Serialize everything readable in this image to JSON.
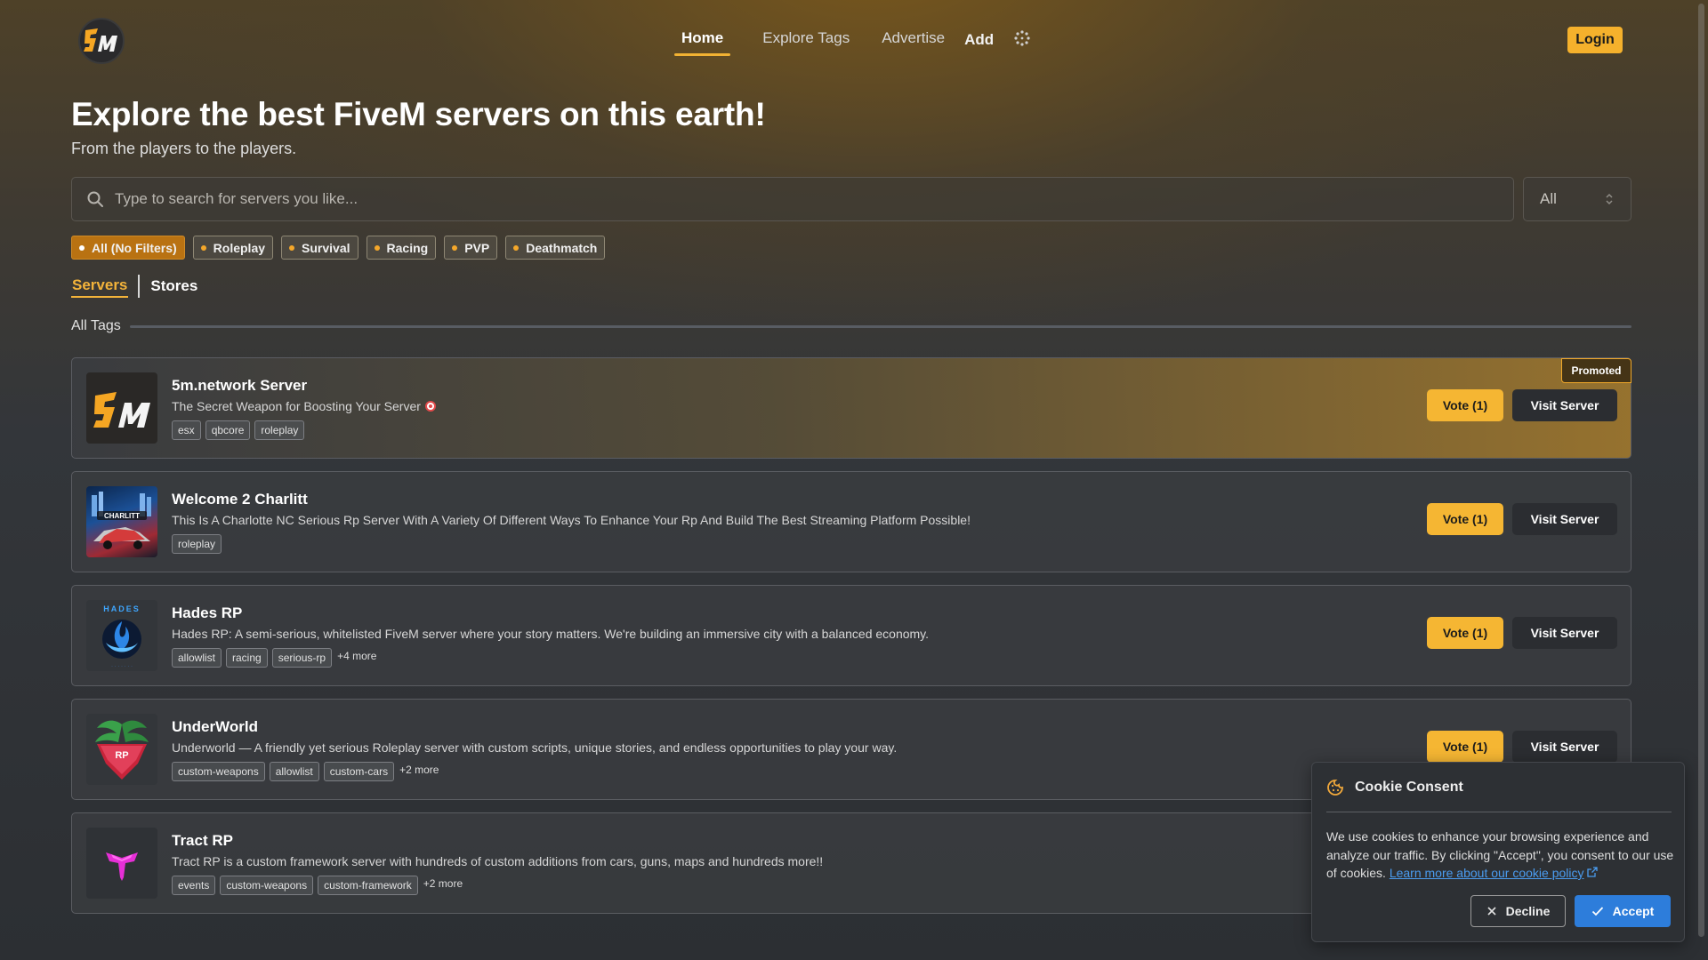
{
  "nav": {
    "items": [
      {
        "label": "Home",
        "active": true
      },
      {
        "label": "Explore Tags",
        "active": false
      },
      {
        "label": "Advertise",
        "active": false
      }
    ],
    "add_label": "Add",
    "login_label": "Login"
  },
  "hero": {
    "title": "Explore the best FiveM servers on this earth!",
    "subtitle": "From the players to the players."
  },
  "search": {
    "placeholder": "Type to search for servers you like...",
    "filter_value": "All"
  },
  "filters": [
    {
      "label": "All (No Filters)",
      "active": true
    },
    {
      "label": "Roleplay",
      "active": false
    },
    {
      "label": "Survival",
      "active": false
    },
    {
      "label": "Racing",
      "active": false
    },
    {
      "label": "PVP",
      "active": false
    },
    {
      "label": "Deathmatch",
      "active": false
    }
  ],
  "tabs": [
    {
      "label": "Servers",
      "active": true
    },
    {
      "label": "Stores",
      "active": false
    }
  ],
  "section_label": "All Tags",
  "servers": [
    {
      "name": "5m.network Server",
      "description": "The Secret Weapon for Boosting Your Server",
      "tags": [
        "esx",
        "qbcore",
        "roleplay"
      ],
      "more": "",
      "vote_label": "Vote (1)",
      "visit_label": "Visit Server",
      "promoted_label": "Promoted"
    },
    {
      "name": "Welcome 2 Charlitt",
      "description": "This Is A Charlotte NC Serious Rp Server With A Variety Of Different Ways To Enhance Your Rp And Build The Best Streaming Platform Possible!",
      "tags": [
        "roleplay"
      ],
      "more": "",
      "vote_label": "Vote (1)",
      "visit_label": "Visit Server",
      "thumb_text": "CHARLITT"
    },
    {
      "name": "Hades RP",
      "description": "Hades RP: A semi-serious, whitelisted FiveM server where your story matters. We're building an immersive city with a balanced economy.",
      "tags": [
        "allowlist",
        "racing",
        "serious-rp"
      ],
      "more": "+4 more",
      "vote_label": "Vote (1)",
      "visit_label": "Visit Server",
      "thumb_text": "HADES"
    },
    {
      "name": "UnderWorld",
      "description": "Underworld — A friendly yet serious Roleplay server with custom scripts, unique stories, and endless opportunities to play your way.",
      "tags": [
        "custom-weapons",
        "allowlist",
        "custom-cars"
      ],
      "more": "+2 more",
      "vote_label": "Vote (1)",
      "visit_label": "Visit Server",
      "thumb_text": "RP"
    },
    {
      "name": "Tract RP",
      "description": "Tract RP is a custom framework server with hundreds of custom additions from cars, guns, maps and hundreds more!!",
      "tags": [
        "events",
        "custom-weapons",
        "custom-framework"
      ],
      "more": "+2 more"
    }
  ],
  "cookie": {
    "title": "Cookie Consent",
    "text": "We use cookies to enhance your browsing experience and analyze our traffic. By clicking \"Accept\", you consent to our use of cookies. ",
    "link_label": "Learn more about our cookie policy",
    "decline_label": "Decline",
    "accept_label": "Accept"
  },
  "colors": {
    "accent": "#f5b633",
    "accept": "#2d7ddb",
    "card_bg": "#3a3c40"
  }
}
